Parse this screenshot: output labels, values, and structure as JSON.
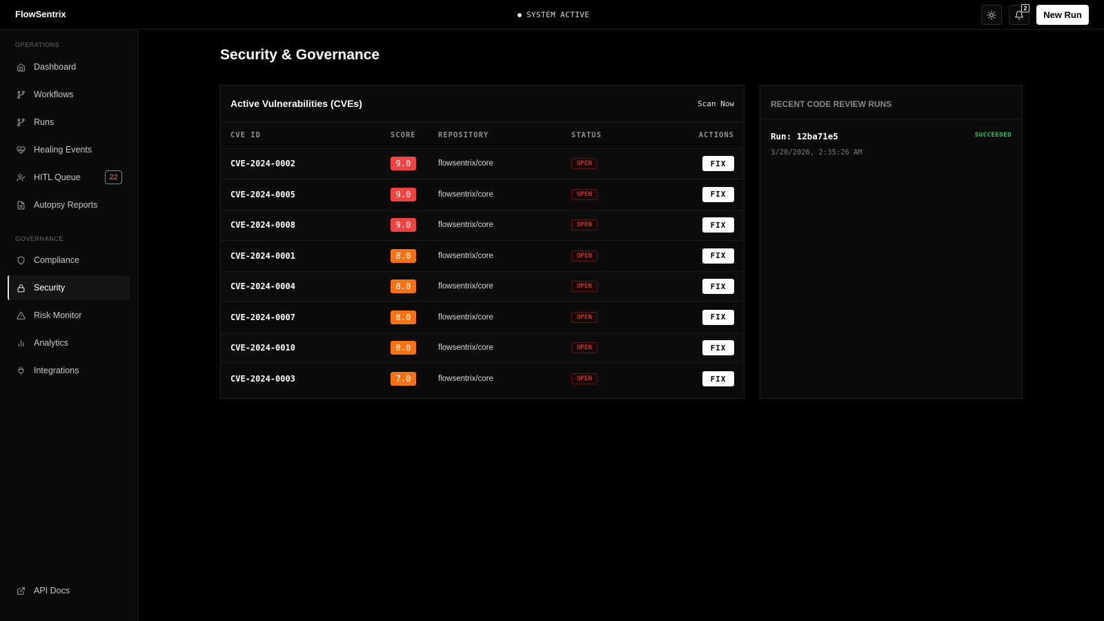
{
  "app": {
    "brand": "FlowSentrix",
    "system_status": "SYSTEM ACTIVE"
  },
  "topbar": {
    "notifications_count": "2",
    "new_run_label": "New Run"
  },
  "sidebar": {
    "sections": [
      {
        "label": "OPERATIONS",
        "items": [
          {
            "label": "Dashboard",
            "icon": "home-icon"
          },
          {
            "label": "Workflows",
            "icon": "git-branch-icon"
          },
          {
            "label": "Runs",
            "icon": "git-branch-icon"
          },
          {
            "label": "Healing Events",
            "icon": "heart-pulse-icon"
          },
          {
            "label": "HITL Queue",
            "icon": "user-check-icon",
            "badge": "22"
          },
          {
            "label": "Autopsy Reports",
            "icon": "file-text-icon"
          }
        ]
      },
      {
        "label": "GOVERNANCE",
        "items": [
          {
            "label": "Compliance",
            "icon": "shield-icon"
          },
          {
            "label": "Security",
            "icon": "lock-icon",
            "active": true
          },
          {
            "label": "Risk Monitor",
            "icon": "alert-triangle-icon"
          },
          {
            "label": "Analytics",
            "icon": "bar-chart-icon"
          },
          {
            "label": "Integrations",
            "icon": "plug-icon"
          }
        ]
      }
    ],
    "footer": {
      "label": "API Docs",
      "icon": "external-link-icon"
    }
  },
  "main": {
    "title": "Security & Governance",
    "cve_panel": {
      "title": "Active Vulnerabilities (CVEs)",
      "scan_label": "Scan Now",
      "columns": [
        "CVE ID",
        "SCORE",
        "REPOSITORY",
        "STATUS",
        "ACTIONS"
      ],
      "rows": [
        {
          "id": "CVE-2024-0002",
          "score": "9.0",
          "severity": "critical",
          "repo": "flowsentrix/core",
          "status": "OPEN",
          "action": "FIX"
        },
        {
          "id": "CVE-2024-0005",
          "score": "9.0",
          "severity": "critical",
          "repo": "flowsentrix/core",
          "status": "OPEN",
          "action": "FIX"
        },
        {
          "id": "CVE-2024-0008",
          "score": "9.0",
          "severity": "critical",
          "repo": "flowsentrix/core",
          "status": "OPEN",
          "action": "FIX"
        },
        {
          "id": "CVE-2024-0001",
          "score": "8.0",
          "severity": "high",
          "repo": "flowsentrix/core",
          "status": "OPEN",
          "action": "FIX"
        },
        {
          "id": "CVE-2024-0004",
          "score": "8.0",
          "severity": "high",
          "repo": "flowsentrix/core",
          "status": "OPEN",
          "action": "FIX"
        },
        {
          "id": "CVE-2024-0007",
          "score": "8.0",
          "severity": "high",
          "repo": "flowsentrix/core",
          "status": "OPEN",
          "action": "FIX"
        },
        {
          "id": "CVE-2024-0010",
          "score": "8.0",
          "severity": "high",
          "repo": "flowsentrix/core",
          "status": "OPEN",
          "action": "FIX"
        },
        {
          "id": "CVE-2024-0003",
          "score": "7.0",
          "severity": "high",
          "repo": "flowsentrix/core",
          "status": "OPEN",
          "action": "FIX"
        }
      ]
    },
    "runs_panel": {
      "title": "RECENT CODE REVIEW RUNS",
      "runs": [
        {
          "id": "Run: 12ba71e5",
          "status": "SUCCEEDED",
          "time": "3/20/2026, 2:35:26 AM"
        }
      ]
    }
  },
  "colors": {
    "critical": "#ef4444",
    "high": "#f97316",
    "success": "#22c55e"
  }
}
